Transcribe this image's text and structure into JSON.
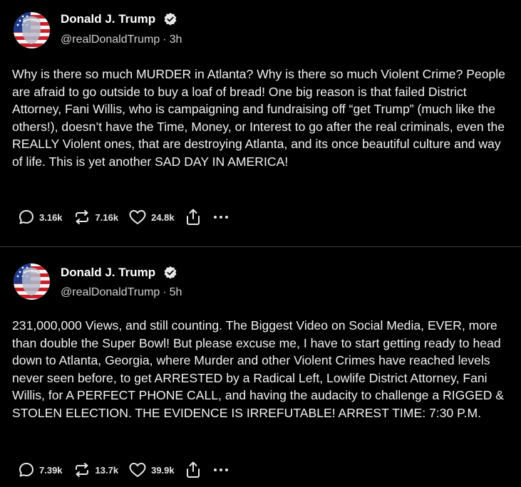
{
  "posts": [
    {
      "author_name": "Donald J. Trump",
      "handle": "@realDonaldTrump",
      "separator": "·",
      "time": "3h",
      "text": "Why is there so much MURDER in Atlanta? Why is there so much Violent Crime? People are afraid to go outside to buy a loaf of bread! One big reason is that failed District Attorney, Fani Willis, who is campaigning and fundraising off “get Trump” (much like the others!), doesn’t have the Time, Money, or Interest to go after the real criminals, even the REALLY Violent ones, that are destroying Atlanta, and its once beautiful culture and way of life. This is yet another SAD DAY IN AMERICA!",
      "replies": "3.16k",
      "retruths": "7.16k",
      "likes": "24.8k"
    },
    {
      "author_name": "Donald J. Trump",
      "handle": "@realDonaldTrump",
      "separator": "·",
      "time": "5h",
      "text": "231,000,000 Views, and still counting. The Biggest Video on Social Media, EVER, more than double the Super Bowl! But please excuse me, I have to start getting ready to head down to Atlanta, Georgia, where Murder and other Violent Crimes have reached levels never seen before, to get ARRESTED by a Radical Left, Lowlife District Attorney, Fani Willis, for A PERFECT PHONE CALL, and having the audacity to challenge a RIGGED & STOLEN ELECTION. THE EVIDENCE IS IRREFUTABLE! ARREST TIME: 7:30 P.M.",
      "replies": "7.39k",
      "retruths": "13.7k",
      "likes": "39.9k"
    }
  ],
  "icons": {
    "verified": "verified-badge-icon",
    "reply": "reply-bubble-icon",
    "retruth": "retruth-arrows-icon",
    "like": "heart-icon",
    "share": "share-upload-icon",
    "more": "more-dots-icon"
  },
  "colors": {
    "background": "#000000",
    "text": "#f2f2f2",
    "secondary_text": "#d0d0d0",
    "divider": "#3a3a3a"
  }
}
